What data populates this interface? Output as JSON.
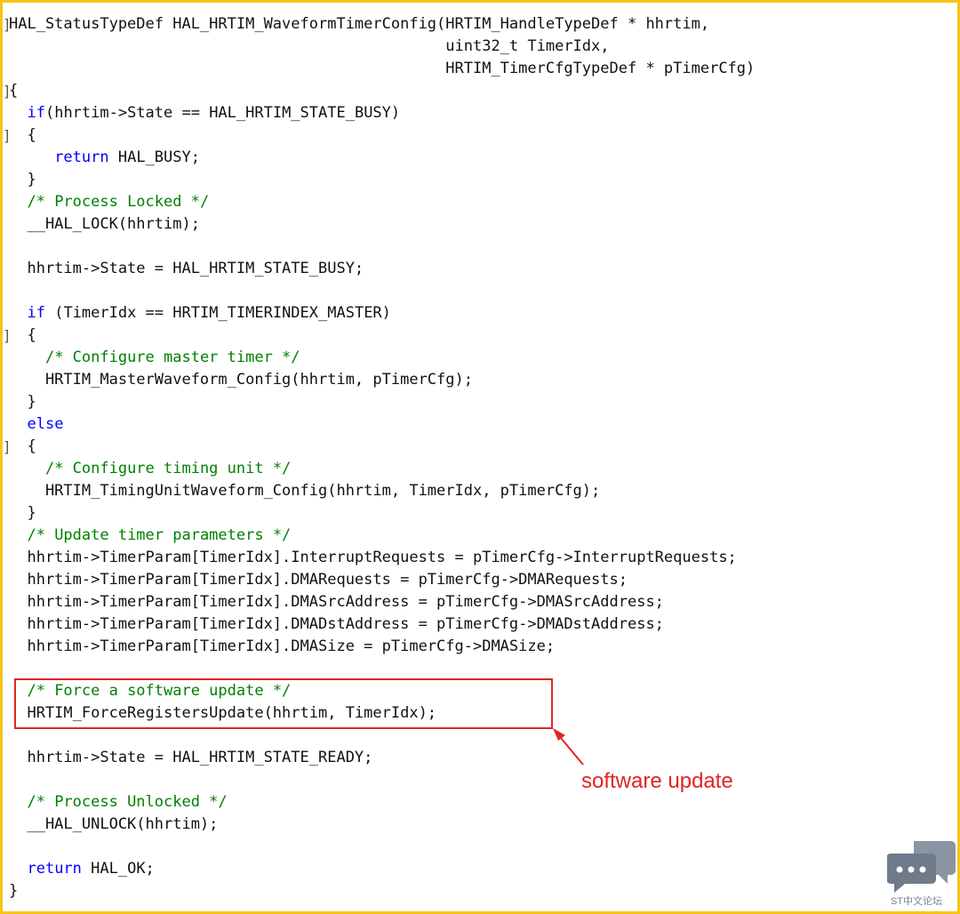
{
  "code_lines": [
    {
      "parts": [
        {
          "t": "HAL_StatusTypeDef HAL_HRTIM_WaveformTimerConfig(HRTIM_HandleTypeDef * hhrtim,"
        }
      ]
    },
    {
      "parts": [
        {
          "t": "                                                uint32_t TimerIdx,"
        }
      ]
    },
    {
      "parts": [
        {
          "t": "                                                HRTIM_TimerCfgTypeDef * pTimerCfg)"
        }
      ]
    },
    {
      "parts": [
        {
          "t": "{"
        }
      ]
    },
    {
      "parts": [
        {
          "t": "  "
        },
        {
          "t": "if",
          "k": "kw"
        },
        {
          "t": "(hhrtim->State == HAL_HRTIM_STATE_BUSY)"
        }
      ]
    },
    {
      "parts": [
        {
          "t": "  {"
        }
      ]
    },
    {
      "parts": [
        {
          "t": "     "
        },
        {
          "t": "return",
          "k": "kw"
        },
        {
          "t": " HAL_BUSY;"
        }
      ]
    },
    {
      "parts": [
        {
          "t": "  }"
        }
      ]
    },
    {
      "parts": [
        {
          "t": "  "
        },
        {
          "t": "/* Process Locked */",
          "k": "cm"
        }
      ]
    },
    {
      "parts": [
        {
          "t": "  __HAL_LOCK(hhrtim);"
        }
      ]
    },
    {
      "parts": [
        {
          "t": ""
        }
      ]
    },
    {
      "parts": [
        {
          "t": "  hhrtim->State = HAL_HRTIM_STATE_BUSY;"
        }
      ]
    },
    {
      "parts": [
        {
          "t": ""
        }
      ]
    },
    {
      "parts": [
        {
          "t": "  "
        },
        {
          "t": "if",
          "k": "kw"
        },
        {
          "t": " (TimerIdx == HRTIM_TIMERINDEX_MASTER)"
        }
      ]
    },
    {
      "parts": [
        {
          "t": "  {"
        }
      ]
    },
    {
      "parts": [
        {
          "t": "    "
        },
        {
          "t": "/* Configure master timer */",
          "k": "cm"
        }
      ]
    },
    {
      "parts": [
        {
          "t": "    HRTIM_MasterWaveform_Config(hhrtim, pTimerCfg);"
        }
      ]
    },
    {
      "parts": [
        {
          "t": "  }"
        }
      ]
    },
    {
      "parts": [
        {
          "t": "  "
        },
        {
          "t": "else",
          "k": "kw"
        }
      ]
    },
    {
      "parts": [
        {
          "t": "  {"
        }
      ]
    },
    {
      "parts": [
        {
          "t": "    "
        },
        {
          "t": "/* Configure timing unit */",
          "k": "cm"
        }
      ]
    },
    {
      "parts": [
        {
          "t": "    HRTIM_TimingUnitWaveform_Config(hhrtim, TimerIdx, pTimerCfg);"
        }
      ]
    },
    {
      "parts": [
        {
          "t": "  }"
        }
      ]
    },
    {
      "parts": [
        {
          "t": "  "
        },
        {
          "t": "/* Update timer parameters */",
          "k": "cm"
        }
      ]
    },
    {
      "parts": [
        {
          "t": "  hhrtim->TimerParam[TimerIdx].InterruptRequests = pTimerCfg->InterruptRequests;"
        }
      ]
    },
    {
      "parts": [
        {
          "t": "  hhrtim->TimerParam[TimerIdx].DMARequests = pTimerCfg->DMARequests;"
        }
      ]
    },
    {
      "parts": [
        {
          "t": "  hhrtim->TimerParam[TimerIdx].DMASrcAddress = pTimerCfg->DMASrcAddress;"
        }
      ]
    },
    {
      "parts": [
        {
          "t": "  hhrtim->TimerParam[TimerIdx].DMADstAddress = pTimerCfg->DMADstAddress;"
        }
      ]
    },
    {
      "parts": [
        {
          "t": "  hhrtim->TimerParam[TimerIdx].DMASize = pTimerCfg->DMASize;"
        }
      ]
    },
    {
      "parts": [
        {
          "t": ""
        }
      ]
    },
    {
      "parts": [
        {
          "t": "  "
        },
        {
          "t": "/* Force a software update */",
          "k": "cm"
        }
      ]
    },
    {
      "parts": [
        {
          "t": "  HRTIM_ForceRegistersUpdate(hhrtim, TimerIdx);"
        }
      ]
    },
    {
      "parts": [
        {
          "t": ""
        }
      ]
    },
    {
      "parts": [
        {
          "t": "  hhrtim->State = HAL_HRTIM_STATE_READY;"
        }
      ]
    },
    {
      "parts": [
        {
          "t": ""
        }
      ]
    },
    {
      "parts": [
        {
          "t": "  "
        },
        {
          "t": "/* Process Unlocked */",
          "k": "cm"
        }
      ]
    },
    {
      "parts": [
        {
          "t": "  __HAL_UNLOCK(hhrtim);"
        }
      ]
    },
    {
      "parts": [
        {
          "t": ""
        }
      ]
    },
    {
      "parts": [
        {
          "t": "  "
        },
        {
          "t": "return",
          "k": "kw"
        },
        {
          "t": " HAL_OK;"
        }
      ]
    },
    {
      "parts": [
        {
          "t": "}"
        }
      ]
    }
  ],
  "annotation": {
    "label": "software update"
  },
  "watermark": {
    "text": "ST中文论坛"
  },
  "colors": {
    "keyword": "#0000ff",
    "comment": "#008000",
    "plain": "#111111",
    "highlight": "#e02424",
    "frame": "#f5c518"
  }
}
